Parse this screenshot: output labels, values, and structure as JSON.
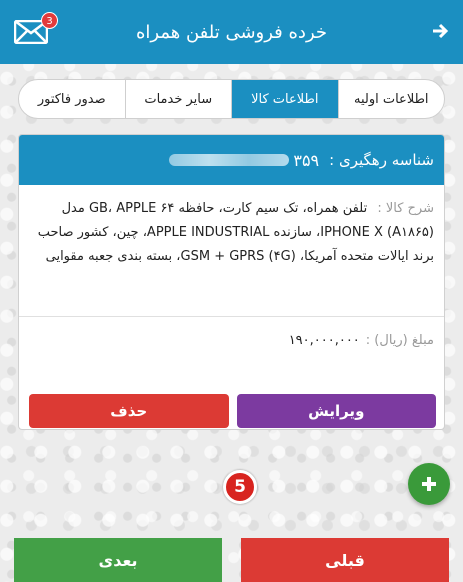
{
  "header": {
    "title": "خرده فروشی تلفن همراه",
    "mail_badge_count": "3",
    "mail_icon": "mail-icon",
    "back_icon": "arrow-right-icon",
    "color": "#1b8fc1"
  },
  "tabs": [
    {
      "label": "اطلاعات اولیه",
      "active": false
    },
    {
      "label": "اطلاعات کالا",
      "active": true
    },
    {
      "label": "سایر خدمات",
      "active": false
    },
    {
      "label": "صدور فاکتور",
      "active": false
    }
  ],
  "card": {
    "tracking_label": "شناسه رهگیری :",
    "tracking_value": "۳۵۹",
    "description_label": "شرح کالا :",
    "description_text": "تلفن همراه، تک سیم کارت، حافظه ۶۴ GB، APPLE مدل IPHONE X (A۱۸۶۵)، سازنده APPLE INDUSTRIAL، چین، کشور صاحب برند ایالات متحده آمریکا، (۴G) GSM + GPRS، بسته بندی جعبه مقوایی",
    "price_label": "مبلغ (ریال) :",
    "price_value": "۱۹۰,۰۰۰,۰۰۰",
    "edit_label": "ویرایش",
    "delete_label": "حذف"
  },
  "step_badge": "5",
  "fab_icon": "plus-icon",
  "nav": {
    "prev_label": "قبلی",
    "next_label": "بعدی"
  },
  "colors": {
    "primary": "#1b8fc1",
    "danger": "#dc3a34",
    "edit": "#7c3aa0",
    "success": "#43a047"
  }
}
